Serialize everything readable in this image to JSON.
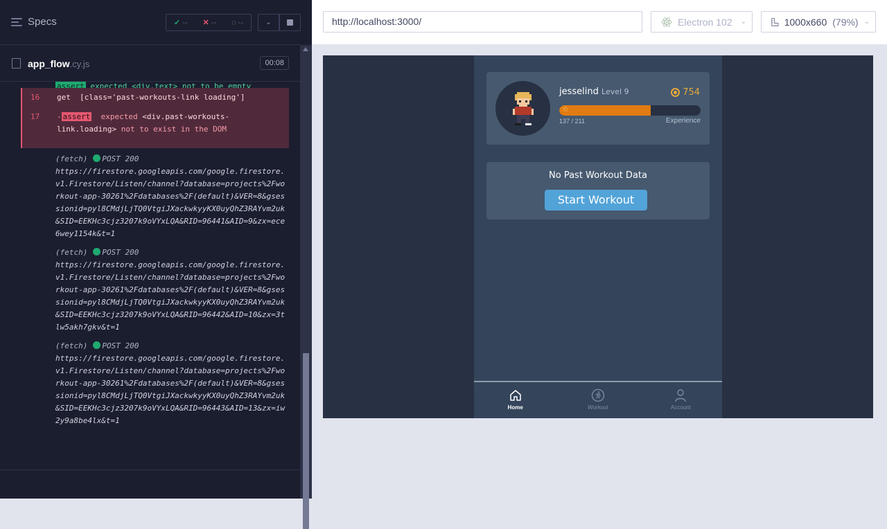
{
  "reporter": {
    "specs_label": "Specs",
    "stats": {
      "passed": "--",
      "failed": "--",
      "pending": "--"
    },
    "file": {
      "name": "app_flow",
      "ext": ".cy.js",
      "duration": "00:08"
    },
    "partial_command": {
      "tag": "assert",
      "text": "expected <div.text> not to be empty"
    },
    "commands": [
      {
        "num": "16",
        "name": "get",
        "message": "[class='past-workouts-link loading']"
      },
      {
        "num": "17",
        "prefix": "-",
        "name": "assert",
        "message_a": "expected",
        "subject": "<div.past-workouts-link.loading>",
        "message_b": "not to exist in the DOM"
      }
    ],
    "fetches": [
      {
        "type": "(fetch)",
        "method": "POST 200",
        "url": "https://firestore.googleapis.com/google.firestore.v1.Firestore/Listen/channel?database=projects%2Fworkout-app-30261%2Fdatabases%2F(default)&VER=8&gsessionid=pyl8CMdjLjTQ0VtgiJXackwkyyKX0uyQhZ3RAYvm2uk&SID=EEKHc3cjz3207k9oVYxLQA&RID=96441&AID=9&zx=ece6wey1154k&t=1"
      },
      {
        "type": "(fetch)",
        "method": "POST 200",
        "url": "https://firestore.googleapis.com/google.firestore.v1.Firestore/Listen/channel?database=projects%2Fworkout-app-30261%2Fdatabases%2F(default)&VER=8&gsessionid=pyl8CMdjLjTQ0VtgiJXackwkyyKX0uyQhZ3RAYvm2uk&SID=EEKHc3cjz3207k9oVYxLQA&RID=96442&AID=10&zx=3tlw5akh7gkv&t=1"
      },
      {
        "type": "(fetch)",
        "method": "POST 200",
        "url": "https://firestore.googleapis.com/google.firestore.v1.Firestore/Listen/channel?database=projects%2Fworkout-app-30261%2Fdatabases%2F(default)&VER=8&gsessionid=pyl8CMdjLjTQ0VtgiJXackwkyyKX0uyQhZ3RAYvm2uk&SID=EEKHc3cjz3207k9oVYxLQA&RID=96443&AID=13&zx=iw2y9a8be4lx&t=1"
      }
    ]
  },
  "aut": {
    "url": "http://localhost:3000/",
    "browser": "Electron 102",
    "viewport": "1000x660",
    "zoom": "(79%)"
  },
  "app": {
    "username": "jesselind",
    "level": "Level 9",
    "coins": "754",
    "xp_text": "137 / 211",
    "xp_fraction": 0.649,
    "xp_label": "Experience",
    "past_title": "No Past Workout Data",
    "start_button": "Start Workout",
    "nav": [
      {
        "label": "Home",
        "icon": "home-icon",
        "active": true
      },
      {
        "label": "Workout",
        "icon": "runner-icon",
        "active": false
      },
      {
        "label": "Account",
        "icon": "user-icon",
        "active": false
      }
    ]
  },
  "colors": {
    "pass": "#1fa971",
    "fail": "#e45770",
    "xp": "#e07b12",
    "coin": "#e6a93a",
    "button": "#52a3d8"
  }
}
